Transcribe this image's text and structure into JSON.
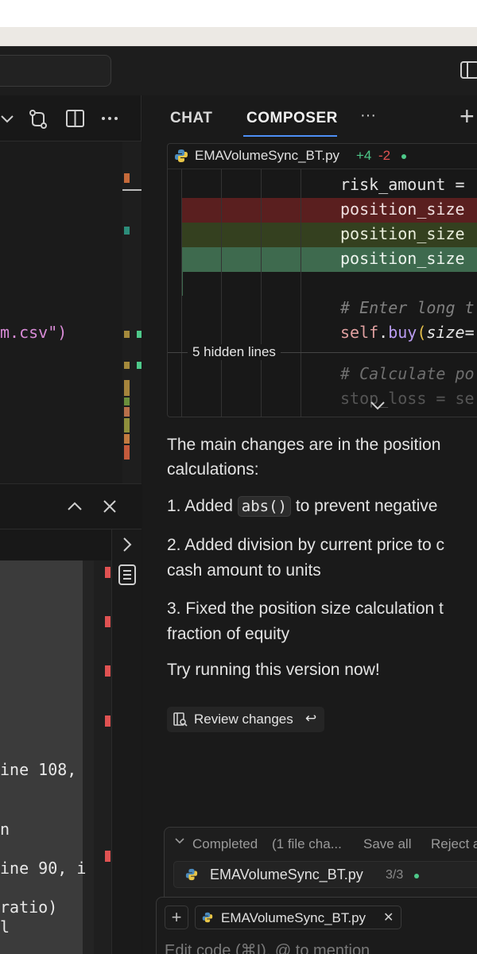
{
  "left_editor": {
    "code_fragment": "m.csv\")"
  },
  "terminal": {
    "lines": [
      "ine 108,",
      "n",
      "ine 90, i",
      "ratio)",
      "l"
    ]
  },
  "composer_panel": {
    "tabs": [
      {
        "label": "CHAT",
        "active": false
      },
      {
        "label": "COMPOSER",
        "active": true
      }
    ],
    "more_label": "···",
    "add_label": "+"
  },
  "diff": {
    "file_name": "EMAVolumeSync_BT.py",
    "additions": "+4",
    "deletions": "-2",
    "hidden_lines_label": "5 hidden lines",
    "lines": [
      {
        "text": "risk_amount =",
        "kind": "context"
      },
      {
        "text": "position_size",
        "kind": "removed"
      },
      {
        "text": "position_size",
        "kind": "added"
      },
      {
        "text": "position_size",
        "kind": "added-strong"
      },
      {
        "text": "",
        "kind": "context"
      },
      {
        "text": "# Enter long t",
        "kind": "comment"
      },
      {
        "text": "self.buy(size=",
        "kind": "call"
      },
      {
        "text": "# Calculate po",
        "kind": "comment"
      },
      {
        "text": "stop_loss = se",
        "kind": "faded"
      }
    ]
  },
  "message": {
    "intro_line1": "The main changes are in the position",
    "intro_line2": "calculations:",
    "item1_prefix": "1. Added",
    "item1_code": "abs()",
    "item1_suffix": "to prevent negative",
    "item2_line1": "2. Added division by current price to c",
    "item2_line2": "cash amount to units",
    "item3_line1": "3. Fixed the position size calculation t",
    "item3_line2": "fraction of equity",
    "closing": "Try running this version now!"
  },
  "review_button": {
    "label": "Review changes"
  },
  "completed": {
    "status": "Completed",
    "summary": "(1 file cha...",
    "save_all": "Save all",
    "reject": "Reject a",
    "file_name": "EMAVolumeSync_BT.py",
    "progress": "3/3"
  },
  "input": {
    "context_file": "EMAVolumeSync_BT.py",
    "placeholder": "Edit code (⌘I), @ to mention"
  },
  "colors": {
    "accent_blue": "#4d8ff5",
    "added_green": "#4ec98a",
    "removed_red": "#e05252"
  }
}
